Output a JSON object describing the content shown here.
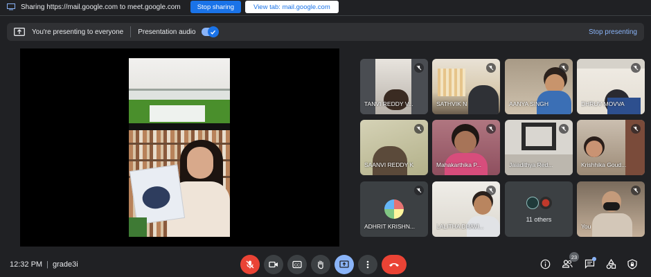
{
  "share_bar": {
    "text": "Sharing https://mail.google.com to meet.google.com",
    "stop_sharing_label": "Stop sharing",
    "view_tab_label": "View tab: mail.google.com"
  },
  "presenting_bar": {
    "status": "You're presenting to everyone",
    "audio_label": "Presentation audio",
    "audio_on": true,
    "stop_label": "Stop presenting"
  },
  "participants": [
    {
      "name": "TANVI REDDY V..."
    },
    {
      "name": "SATHVIK N"
    },
    {
      "name": "AANYA SINGH"
    },
    {
      "name": "DHRUV MOVVA"
    },
    {
      "name": "SAANVI REDDY K"
    },
    {
      "name": "Mahakarthika P..."
    },
    {
      "name": "Jaiadithya Red..."
    },
    {
      "name": "Krishhika Goud..."
    },
    {
      "name": "ADHRIT KRISHN..."
    },
    {
      "name": "LALITHA DHAVI..."
    },
    {
      "name": "11 others"
    },
    {
      "name": "You"
    }
  ],
  "bottom": {
    "time": "12:32 PM",
    "meeting": "grade3i",
    "people_count": "23"
  },
  "colors": {
    "background": "#202124",
    "accent": "#1a73e8",
    "danger": "#ea4335",
    "tile": "#3c4043"
  }
}
